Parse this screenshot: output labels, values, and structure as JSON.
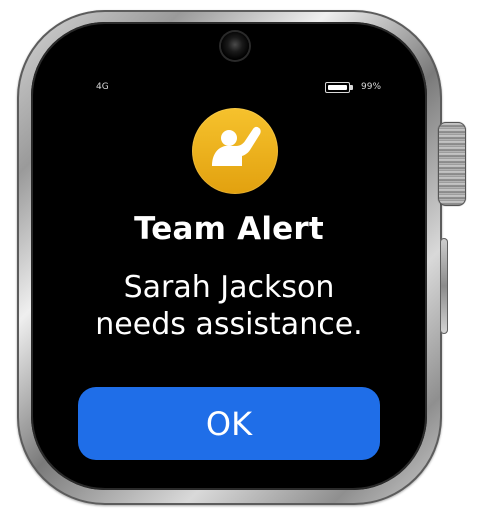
{
  "status": {
    "network": "4G",
    "battery": "99%",
    "battery_level": 0.99
  },
  "notification": {
    "icon": "raised-hand-person-icon",
    "title": "Team Alert",
    "message": "Sarah Jackson needs assistance."
  },
  "actions": {
    "ok_label": "OK"
  },
  "colors": {
    "accent": "#1f6ee8",
    "icon_bg": "#f2b51f",
    "screen_bg": "#000000"
  }
}
